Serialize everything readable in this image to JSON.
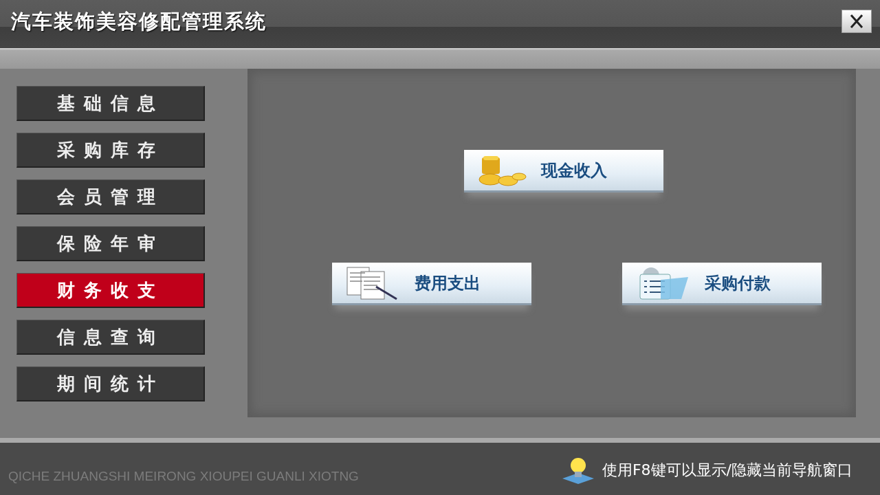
{
  "window": {
    "title": "汽车装饰美容修配管理系统"
  },
  "sidebar": {
    "items": [
      {
        "label": "基础信息",
        "selected": false
      },
      {
        "label": "采购库存",
        "selected": false
      },
      {
        "label": "会员管理",
        "selected": false
      },
      {
        "label": "保险年审",
        "selected": false
      },
      {
        "label": "财务收支",
        "selected": true
      },
      {
        "label": "信息查询",
        "selected": false
      },
      {
        "label": "期间统计",
        "selected": false
      }
    ]
  },
  "actions": [
    {
      "label": "现金收入",
      "kind": "coins"
    },
    {
      "label": "费用支出",
      "kind": "documents"
    },
    {
      "label": "采购付款",
      "kind": "folder"
    }
  ],
  "status_bar": {
    "pinyin": "QICHE ZHUANGSHI MEIRONG XIOUPEI GUANLI XIOTNG",
    "hint": "使用F8键可以显示/隐藏当前导航窗口"
  }
}
